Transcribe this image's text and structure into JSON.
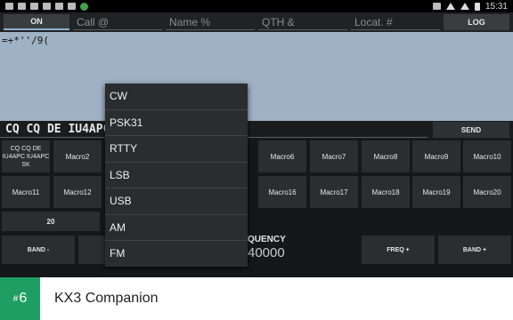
{
  "statusbar": {
    "time": "15:31"
  },
  "toolbar": {
    "on_label": "ON",
    "fields": [
      {
        "placeholder": "Call @"
      },
      {
        "placeholder": "Name %"
      },
      {
        "placeholder": "QTH &"
      },
      {
        "placeholder": "Locat. #"
      }
    ],
    "log_label": "LOG"
  },
  "rx": {
    "text": "=+*''/9("
  },
  "tx": {
    "value": "CQ CQ DE IU4APC",
    "send_label": "SEND"
  },
  "macros_row1": [
    "CQ CQ DE IU4APC IU4APC SK",
    "Macro2",
    "Macro6",
    "Macro7",
    "Macro8",
    "Macro9",
    "Macro10"
  ],
  "macros_row2": [
    "Macro11",
    "Macro12",
    "Macro16",
    "Macro17",
    "Macro18",
    "Macro19",
    "Macro20"
  ],
  "speed_label": "20",
  "band_minus_label": "BAND -",
  "freq_label": "QUENCY",
  "freq_value": "40000",
  "freq_plus_label": "FREQ +",
  "band_plus_label": "BAND +",
  "mode_dropdown": {
    "options": [
      "CW",
      "PSK31",
      "RTTY",
      "LSB",
      "USB",
      "AM",
      "FM"
    ]
  },
  "banner": {
    "rank": "6",
    "title": "KX3 Companion"
  },
  "colors": {
    "rx_background": "#9fb1c4",
    "badge": "#1f9e63"
  }
}
